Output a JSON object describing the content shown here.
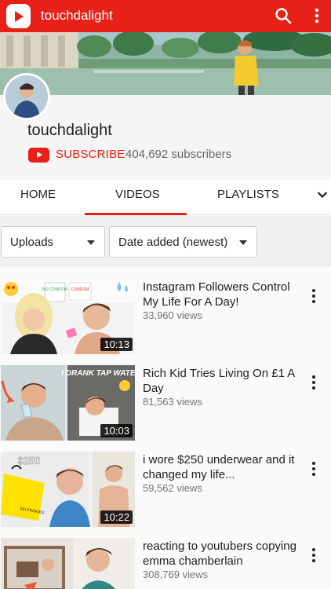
{
  "appbar": {
    "title": "touchdalight",
    "logo_icon": "youtube-logo-icon",
    "search_icon": "search-icon",
    "menu_icon": "more-vert-icon"
  },
  "channel": {
    "name": "touchdalight",
    "subscribe_label": "SUBSCRIBE",
    "subscriber_count": "404,692 subscribers"
  },
  "tabs": [
    {
      "label": "HOME"
    },
    {
      "label": "VIDEOS",
      "selected": true
    },
    {
      "label": "PLAYLISTS"
    }
  ],
  "filters": {
    "uploads": "Uploads",
    "sort": "Date added (newest)"
  },
  "thumb_text": {
    "v1_a": "NO CONDOM",
    "v1_b": "CONDOM",
    "v2": "I DRANK TAP WATER",
    "v3": "$250",
    "v3_bag": "SELFRIDGES"
  },
  "videos": [
    {
      "title": "Instagram Followers Control My Life For A Day!",
      "views": "33,960 views",
      "duration": "10:13"
    },
    {
      "title": "Rich Kid Tries Living On £1 A Day",
      "views": "81,563 views",
      "duration": "10:03"
    },
    {
      "title": "i wore $250 underwear and it changed my life...",
      "views": "59,562 views",
      "duration": "10:22"
    },
    {
      "title": "reacting to youtubers copying emma chamberlain",
      "views": "308,769 views",
      "duration": ""
    }
  ],
  "colors": {
    "brand_red": "#e62117",
    "text_primary": "#212121",
    "text_secondary": "#757575"
  }
}
